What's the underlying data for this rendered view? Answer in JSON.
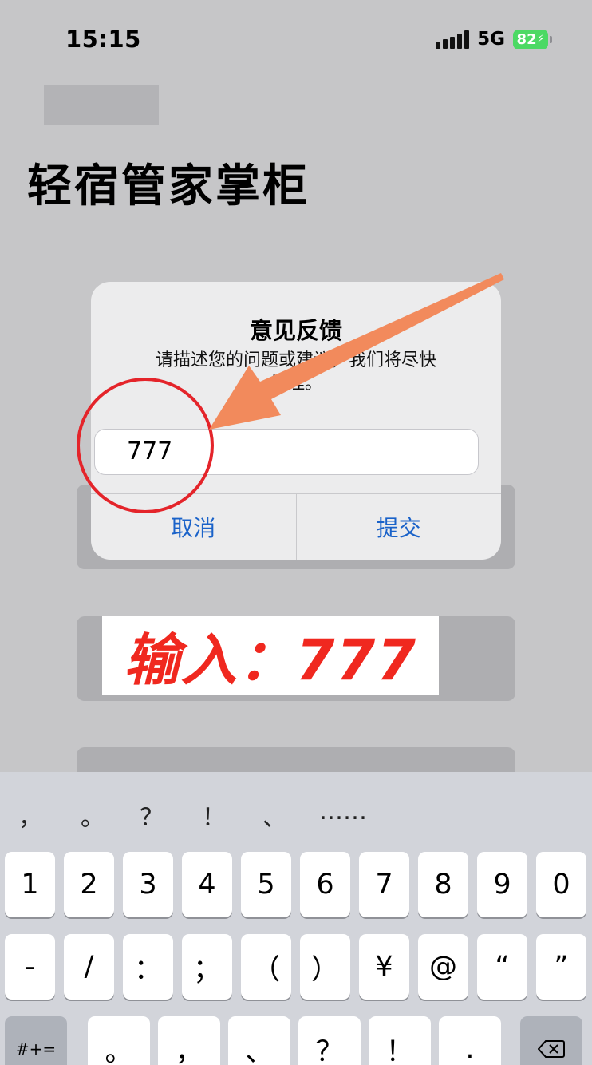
{
  "status_bar": {
    "time": "15:15",
    "network": "5G",
    "battery": "82"
  },
  "app": {
    "title": "轻宿管家掌柜"
  },
  "dialog": {
    "title": "意见反馈",
    "message": "请描述您的问题或建议，我们将尽快处理。",
    "input_value": "777",
    "cancel_label": "取消",
    "submit_label": "提交"
  },
  "annotation": {
    "banner_text": "输入：777"
  },
  "keyboard": {
    "suggestions": [
      "，",
      "。",
      "？",
      "！",
      "、",
      "……"
    ],
    "row1": [
      "1",
      "2",
      "3",
      "4",
      "5",
      "6",
      "7",
      "8",
      "9",
      "0"
    ],
    "row2": [
      "-",
      "/",
      "：",
      "；",
      "（",
      "）",
      "¥",
      "@",
      "“",
      "”"
    ],
    "row3": {
      "mode": "#+=",
      "keys": [
        "。",
        "，",
        "、",
        "？",
        "！",
        "."
      ]
    }
  },
  "colors": {
    "accent": "#1a62c9",
    "annotation_red": "#e4242a",
    "arrow": "#f28a5c"
  }
}
